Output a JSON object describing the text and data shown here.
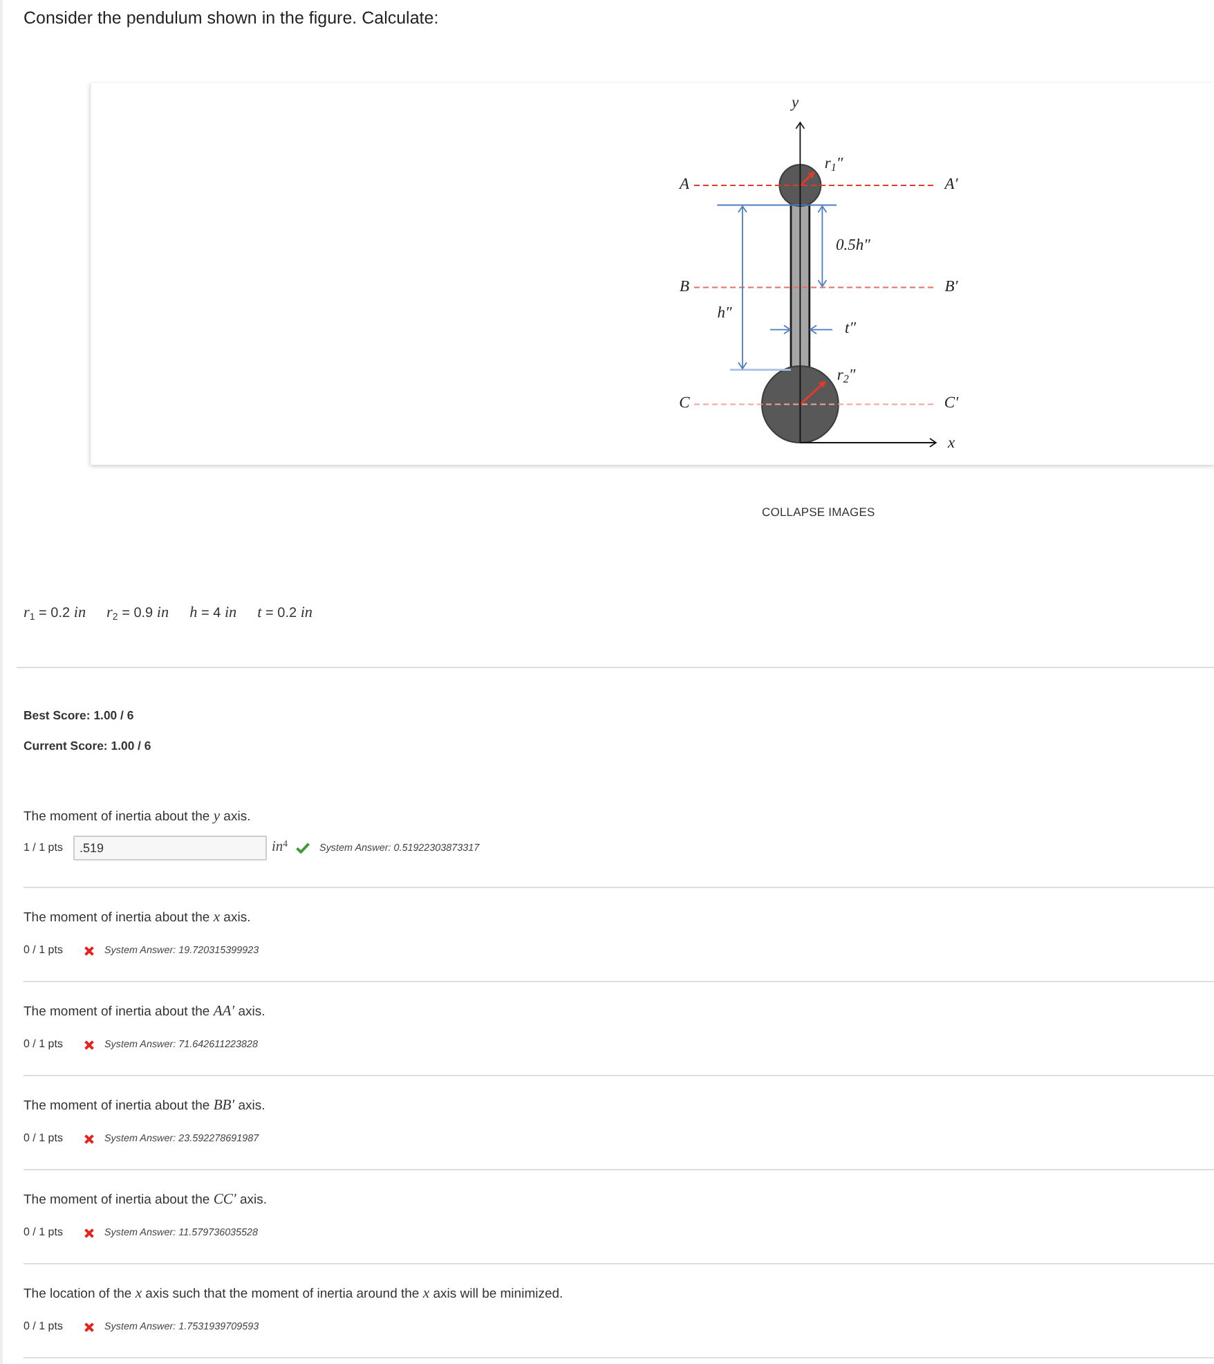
{
  "prompt": "Consider the pendulum shown in the figure. Calculate:",
  "figure": {
    "labels": [
      "y",
      "A",
      "A′",
      "r$_{1}$″",
      "0.5h″",
      "B",
      "B′",
      "h″",
      "t″",
      "r$_{2}$″",
      "C",
      "C′",
      "x"
    ]
  },
  "collapse_link": "COLLAPSE IMAGES",
  "given_values": [
    "*r*$_{1}$ = 0.2 *in*",
    "*r*$_{2}$ = 0.9 *in*",
    "*h* = 4 *in*",
    "*t* = 0.2 *in*"
  ],
  "scores": [
    "Best Score: 1.00 / 6",
    "Current Score: 1.00 / 6"
  ],
  "questions": [
    {
      "prompt": "The moment of inertia about the *y* axis.",
      "points": "1 / 1 pts",
      "answer": ".519",
      "unit": "in$^{4}$",
      "correct": true,
      "system_answer": "System Answer: 0.51922303873317"
    },
    {
      "prompt": "The moment of inertia about the *x* axis.",
      "points": "0 / 1 pts",
      "correct": false,
      "system_answer": "System Answer: 19.720315399923"
    },
    {
      "prompt": "The moment of inertia about the *AA′* axis.",
      "points": "0 / 1 pts",
      "correct": false,
      "system_answer": "System Answer: 71.642611223828"
    },
    {
      "prompt": "The moment of inertia about the *BB′* axis.",
      "points": "0 / 1 pts",
      "correct": false,
      "system_answer": "System Answer: 23.592278691987"
    },
    {
      "prompt": "The moment of inertia about the *CC′* axis.",
      "points": "0 / 1 pts",
      "correct": false,
      "system_answer": "System Answer: 11.579736035528"
    },
    {
      "prompt": "The location of the *x* axis such that the moment of inertia around the *x* axis will be minimized.",
      "points": "0 / 1 pts",
      "correct": false,
      "system_answer": "System Answer: 1.7531939709593"
    }
  ]
}
